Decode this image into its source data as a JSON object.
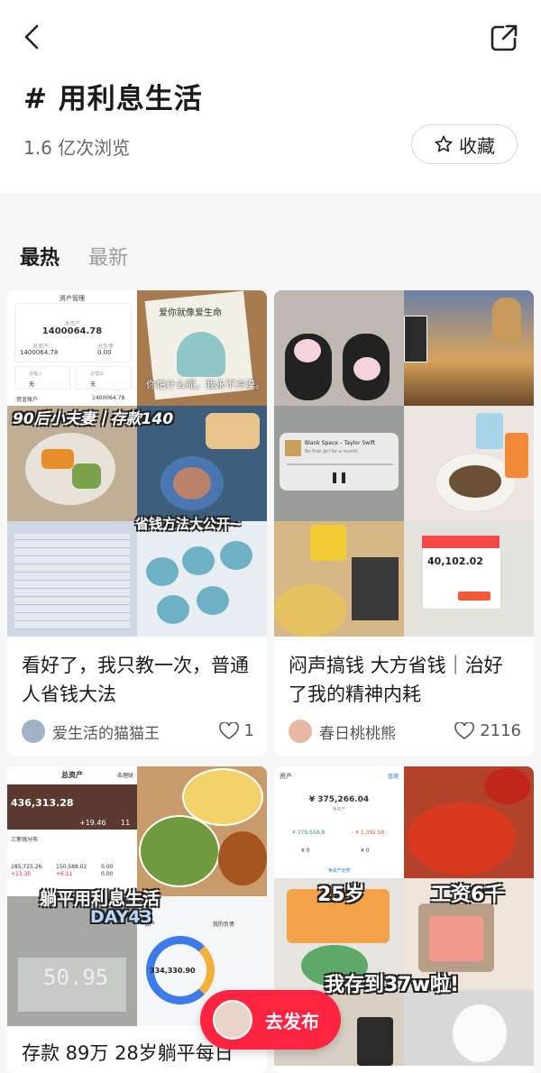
{
  "header": {
    "title": "# 用利息生活",
    "views": "1.6 亿次浏览",
    "favorite_label": "收藏"
  },
  "tabs": [
    {
      "label": "最热",
      "active": true
    },
    {
      "label": "最新",
      "active": false
    }
  ],
  "cards": [
    {
      "title": "看好了，我只教一次，普通人省钱大法",
      "author": "爱生活的猫猫王",
      "likes": "1",
      "overlay": {
        "asset_header": "资产管理",
        "net_asset_label": "净资产",
        "net_asset_value": "1400064.78",
        "total_asset_label": "总资产",
        "total_asset_value": "1400064.78",
        "total_liability_label": "总负债",
        "total_liability_value": "0.00",
        "in_label": "近借入",
        "in_value": "无",
        "out_label": "近借出",
        "out_value": "无",
        "fund_label": "资金账户",
        "fund_value": "1400064.78",
        "book_title": "爱你就像爱生命",
        "book_caption": "你怕什么呢，我永不冷漠。",
        "banner": "90后小夫妻丨存款140",
        "tip": "省钱方法大公开~"
      }
    },
    {
      "title": "闷声搞钱 大方省钱｜治好了我的精神内耗",
      "author": "春日桃桃熊",
      "likes": "2116",
      "overlay": {
        "song": "Blank Space – Taylor Swift",
        "song_sub": "Be that girl for a month",
        "amount": "40,102.02"
      }
    },
    {
      "title": "存款 89万 28岁躺平每日",
      "overlay": {
        "header": "总资产",
        "header_right": "去理财",
        "value": "436,313.28",
        "change": "+19.46",
        "days": "11",
        "dist_label": "三笔钱分布",
        "v1": "285,725.26",
        "v2": "150,588.02",
        "v3": "0.00",
        "d1": "+13.35",
        "d2": "+6.11",
        "d3": "0.00",
        "banner": "躺平用利息生活",
        "day": "DAY43",
        "scale": "50.95",
        "donut_value": "334,330.90",
        "tab1": "资产",
        "tab2": "我的负债"
      }
    },
    {
      "overlay": {
        "net_label": "资产",
        "manage": "管理",
        "value": "¥ 375,266.04",
        "sub": "净资产",
        "pos": "¥ 376,658.8",
        "neg": "- ¥ 1,392.56",
        "zero1": "¥ 0",
        "zero2": "¥ 0",
        "trend": "净资产走势",
        "age": "25岁",
        "salary": "工资6千",
        "saved": "我存到37w啦!"
      }
    }
  ],
  "publish": {
    "label": "去发布"
  }
}
